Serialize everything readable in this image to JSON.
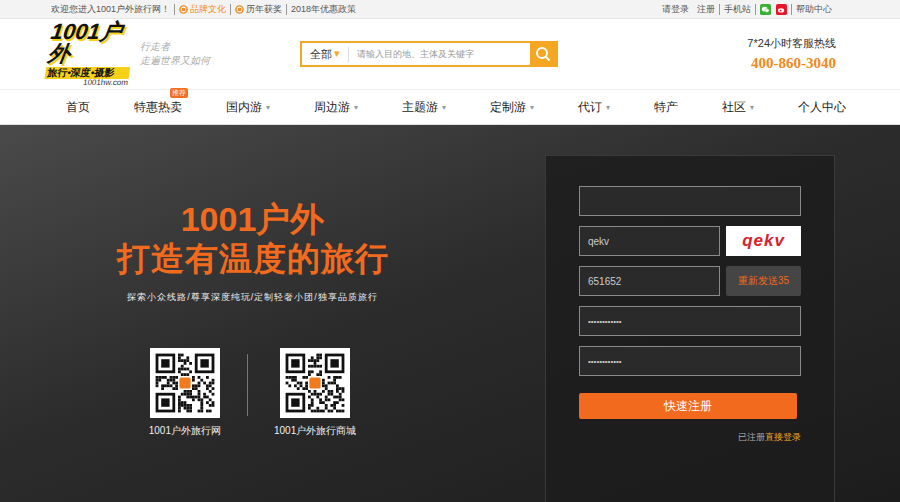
{
  "top_bar": {
    "welcome": "欢迎您进入1001户外旅行网！",
    "links": [
      {
        "label": "品牌文化",
        "highlight": true,
        "icon": true
      },
      {
        "label": "历年获奖",
        "highlight": false,
        "icon": true
      },
      {
        "label": "2018年优惠政策",
        "highlight": false,
        "icon": false
      }
    ],
    "account_links": [
      "请登录",
      "注册"
    ],
    "mobile": "手机站",
    "help": "帮助中心"
  },
  "header": {
    "logo": {
      "main": "1001户外",
      "sub": "旅行•深度•摄影",
      "domain": "1001hw.com"
    },
    "slogan_lines": [
      "行走者",
      "走遍世界又如何"
    ],
    "search": {
      "category": "全部",
      "arrow": "▾",
      "placeholder": "请输入目的地、主体及关键字"
    },
    "hotline": {
      "label": "7*24小时客服热线",
      "number": "400-860-3040"
    }
  },
  "nav": {
    "dropdown_glyph": "▾",
    "items": [
      {
        "label": "首页",
        "dropdown": false,
        "badge": ""
      },
      {
        "label": "特惠热卖",
        "dropdown": false,
        "badge": "推荐"
      },
      {
        "label": "国内游",
        "dropdown": true,
        "badge": ""
      },
      {
        "label": "周边游",
        "dropdown": true,
        "badge": ""
      },
      {
        "label": "主题游",
        "dropdown": true,
        "badge": ""
      },
      {
        "label": "定制游",
        "dropdown": true,
        "badge": ""
      },
      {
        "label": "代订",
        "dropdown": true,
        "badge": ""
      },
      {
        "label": "特产",
        "dropdown": false,
        "badge": ""
      },
      {
        "label": "社区",
        "dropdown": true,
        "badge": ""
      },
      {
        "label": "个人中心",
        "dropdown": false,
        "badge": ""
      }
    ]
  },
  "hero": {
    "title": "1001户外",
    "headline": "打造有温度的旅行",
    "tagline": "探索小众线路/尊享深度纯玩/定制轻奢小团/独享品质旅行",
    "qr_codes": [
      {
        "caption": "1001户外旅行网"
      },
      {
        "caption": "1001户外旅行商城"
      }
    ]
  },
  "form": {
    "fields": [
      {
        "kind": "text",
        "value": ""
      },
      {
        "kind": "captcha",
        "value": "qekv",
        "captcha": "qekv"
      },
      {
        "kind": "sms",
        "value": "651652",
        "button": "重新发送35"
      },
      {
        "kind": "password",
        "value": "••••••••••••"
      },
      {
        "kind": "password",
        "value": "••••••••••••"
      }
    ],
    "submit": "快速注册",
    "login_prompt": "已注册",
    "login_link": "直接登录"
  }
}
